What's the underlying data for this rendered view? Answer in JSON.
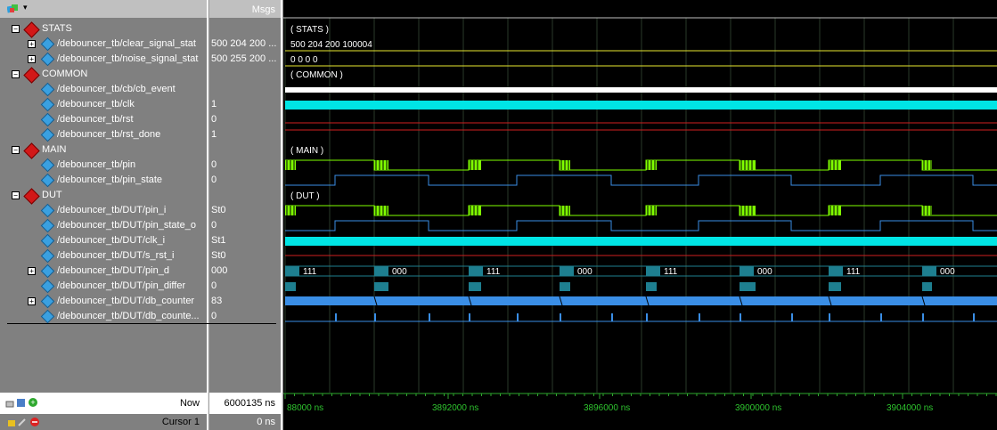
{
  "header": {
    "values_label": "Msgs",
    "dropdown_glyph": "▾"
  },
  "colors": {
    "wave_green": "#7fff00",
    "wave_cyan": "#00e5e5",
    "wave_blue": "#3a8ee6",
    "wave_red": "#d02020",
    "wave_yellow": "#e8e830",
    "bus_teal": "#1e7f90",
    "grid": "#2a3a2a"
  },
  "signals": [
    {
      "kind": "group",
      "name": "STATS",
      "value": "",
      "wave_text": "( STATS )"
    },
    {
      "kind": "signal",
      "expandable": true,
      "name": "/debouncer_tb/clear_signal_stat",
      "value": "500 204 200 ...",
      "wave_text": "500 204 200 100004"
    },
    {
      "kind": "signal",
      "expandable": true,
      "name": "/debouncer_tb/noise_signal_stat",
      "value": "500 255 200 ...",
      "wave_text": "0 0 0 0"
    },
    {
      "kind": "group",
      "name": "COMMON",
      "value": "",
      "wave_text": "( COMMON )"
    },
    {
      "kind": "signal",
      "expandable": false,
      "name": "/debouncer_tb/cb/cb_event",
      "value": "",
      "wave_text": ""
    },
    {
      "kind": "signal",
      "expandable": false,
      "name": "/debouncer_tb/clk",
      "value": "1",
      "wave_text": ""
    },
    {
      "kind": "signal",
      "expandable": false,
      "name": "/debouncer_tb/rst",
      "value": "0",
      "wave_text": ""
    },
    {
      "kind": "signal",
      "expandable": false,
      "name": "/debouncer_tb/rst_done",
      "value": "1",
      "wave_text": ""
    },
    {
      "kind": "group",
      "name": "MAIN",
      "value": "",
      "wave_text": "( MAIN )"
    },
    {
      "kind": "signal",
      "expandable": false,
      "name": "/debouncer_tb/pin",
      "value": "0",
      "wave_text": ""
    },
    {
      "kind": "signal",
      "expandable": false,
      "name": "/debouncer_tb/pin_state",
      "value": "0",
      "wave_text": ""
    },
    {
      "kind": "group",
      "name": "DUT",
      "value": "",
      "wave_text": "( DUT )"
    },
    {
      "kind": "signal",
      "expandable": false,
      "name": "/debouncer_tb/DUT/pin_i",
      "value": "St0",
      "wave_text": ""
    },
    {
      "kind": "signal",
      "expandable": false,
      "name": "/debouncer_tb/DUT/pin_state_o",
      "value": "0",
      "wave_text": ""
    },
    {
      "kind": "signal",
      "expandable": false,
      "name": "/debouncer_tb/DUT/clk_i",
      "value": "St1",
      "wave_text": ""
    },
    {
      "kind": "signal",
      "expandable": false,
      "name": "/debouncer_tb/DUT/s_rst_i",
      "value": "St0",
      "wave_text": ""
    },
    {
      "kind": "signal",
      "expandable": true,
      "name": "/debouncer_tb/DUT/pin_d",
      "value": "000",
      "wave_text": ""
    },
    {
      "kind": "signal",
      "expandable": false,
      "name": "/debouncer_tb/DUT/pin_differ",
      "value": "0",
      "wave_text": ""
    },
    {
      "kind": "signal",
      "expandable": true,
      "name": "/debouncer_tb/DUT/db_counter",
      "value": "83",
      "wave_text": ""
    },
    {
      "kind": "signal",
      "expandable": false,
      "name": "/debouncer_tb/DUT/db_counte...",
      "value": "0",
      "wave_text": ""
    }
  ],
  "pin_d_labels": [
    "111",
    "000",
    "111",
    "000",
    "111",
    "000",
    "111",
    "000"
  ],
  "status": {
    "now_label": "Now",
    "now_value": "6000135 ns",
    "cursor_label": "Cursor 1",
    "cursor_value": "0 ns"
  },
  "timeline": {
    "labels": [
      "88000 ns",
      "3892000 ns",
      "3896000 ns",
      "3900000 ns",
      "3904000 ns"
    ]
  }
}
